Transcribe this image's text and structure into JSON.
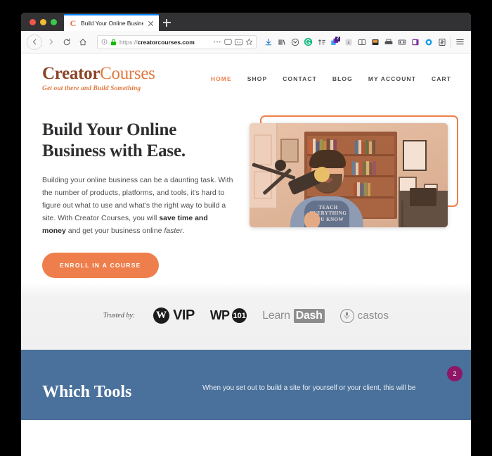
{
  "browser": {
    "tab": {
      "title": "Build Your Online Business with",
      "favicon_letter": "C",
      "favicon_name": "creator-courses-favicon",
      "close_icon": "close-icon"
    },
    "newtab_label": "+",
    "url": {
      "protocol": "https://",
      "host": "creatorcourses.com",
      "full": "https://creatorcourses.com",
      "info_icon": "info-circle-icon",
      "lock_icon": "padlock-icon"
    },
    "nav_buttons": [
      "back-icon",
      "forward-icon",
      "reload-icon",
      "home-icon"
    ],
    "urlbar_buttons": [
      "page-actions-ellipsis-icon",
      "reader-view-icon",
      "screenshot-icon",
      "bookmark-star-icon"
    ],
    "toolbar_icons": [
      "downloads-icon",
      "library-icon",
      "pocket-icon",
      "grammarly-icon",
      "sort-tabs-icon",
      "extension-badge-icon",
      "container-tabs-icon",
      "split-view-icon",
      "color-picker-icon",
      "printer-icon",
      "qr-code-icon",
      "onenote-icon",
      "bubble-icon",
      "money-icon",
      "hamburger-menu-icon"
    ],
    "extension_badge_count": "2"
  },
  "site": {
    "logo": {
      "part1": "Creator",
      "part2": "Courses",
      "tagline": "Get out there and Build Something"
    },
    "nav": [
      {
        "label": "HOME",
        "active": true
      },
      {
        "label": "SHOP",
        "active": false
      },
      {
        "label": "CONTACT",
        "active": false
      },
      {
        "label": "BLOG",
        "active": false
      },
      {
        "label": "MY ACCOUNT",
        "active": false
      },
      {
        "label": "CART",
        "active": false
      }
    ],
    "hero": {
      "title_line1": "Build Your Online",
      "title_line2": "Business with Ease.",
      "paragraph_pre": "Building your online business can be a daunting task. With the number of products, platforms, and tools, it's hard to figure out what to use and what's the right way to build a site. With Creator Courses, you will ",
      "paragraph_bold": "save time and money",
      "paragraph_mid": " and get your business online ",
      "paragraph_italic": "faster",
      "paragraph_post": ".",
      "cta_label": "ENROLL IN A COURSE",
      "video_alt": "host speaking into studio microphone in front of bookshelf",
      "video_shirt_text": "TEACH EVERYTHING YOU KNOW"
    },
    "trusted": {
      "label": "Trusted by:",
      "logos": [
        {
          "name": "wordpress-vip-logo",
          "mark": "W",
          "text": "VIP"
        },
        {
          "name": "wp101-logo",
          "text": "WP",
          "mark": "101"
        },
        {
          "name": "learndash-logo",
          "text_light": "Learn",
          "text_dark": "Dash"
        },
        {
          "name": "castos-logo",
          "mark": "mic",
          "text": "castos"
        }
      ]
    },
    "section_blue": {
      "title": "Which Tools",
      "paragraph": "When you set out to build a site for yourself or your client, this will be"
    },
    "colors": {
      "brand_orange": "#ee7f4c",
      "logo_brown": "#8a4526",
      "section_blue": "#4a719b",
      "badge_purple": "#8e1667"
    }
  }
}
